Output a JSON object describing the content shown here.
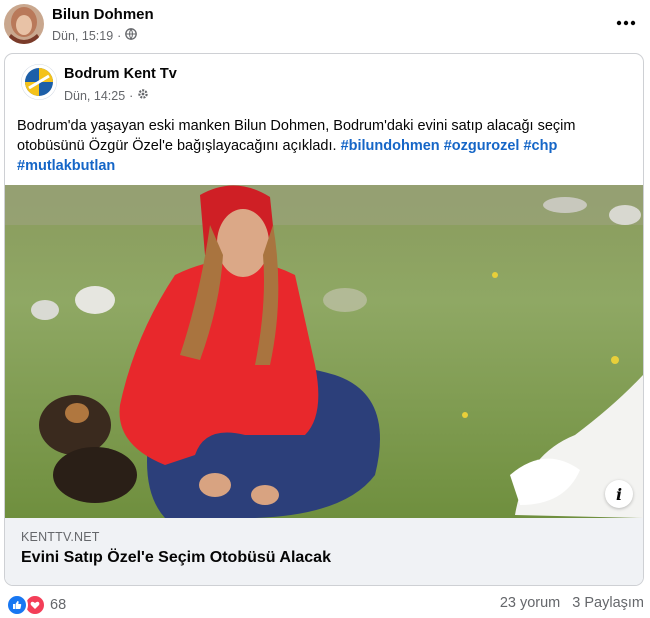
{
  "outer_post": {
    "author": "Bilun Dohmen",
    "time": "Dün, 15:19",
    "separator": "·",
    "audience_icon": "globe-icon",
    "more_icon": "more-dots-icon"
  },
  "shared_post": {
    "page_name": "Bodrum Kent Tv",
    "time": "Dün, 14:25",
    "separator": "·",
    "audience_icon": "gear-icon",
    "text": "Bodrum'da yaşayan eski manken Bilun Dohmen, Bodrum'daki evini satıp alacağı seçim otobüsünü Özgür Özel'e bağışlayacağını açıkladı.",
    "hashtags": [
      "#bilundohmen",
      "#ozgurozel",
      "#chp",
      "#mutlakbutlan"
    ],
    "link": {
      "domain": "KENTTV.NET",
      "title": "Evini Satıp Özel'e Seçim Otobüsü Alacak",
      "info_icon": "info-icon"
    }
  },
  "footer": {
    "reaction_icons": [
      "like-icon",
      "love-icon"
    ],
    "reaction_count": "68",
    "comments": "23 yorum",
    "shares": "3 Paylaşım"
  },
  "colors": {
    "hashtag": "#1566c7",
    "secondary_text": "#65676b",
    "link_bar_bg": "#f0f2f5",
    "like_blue": "#1877f2",
    "love_red": "#f33e58"
  }
}
